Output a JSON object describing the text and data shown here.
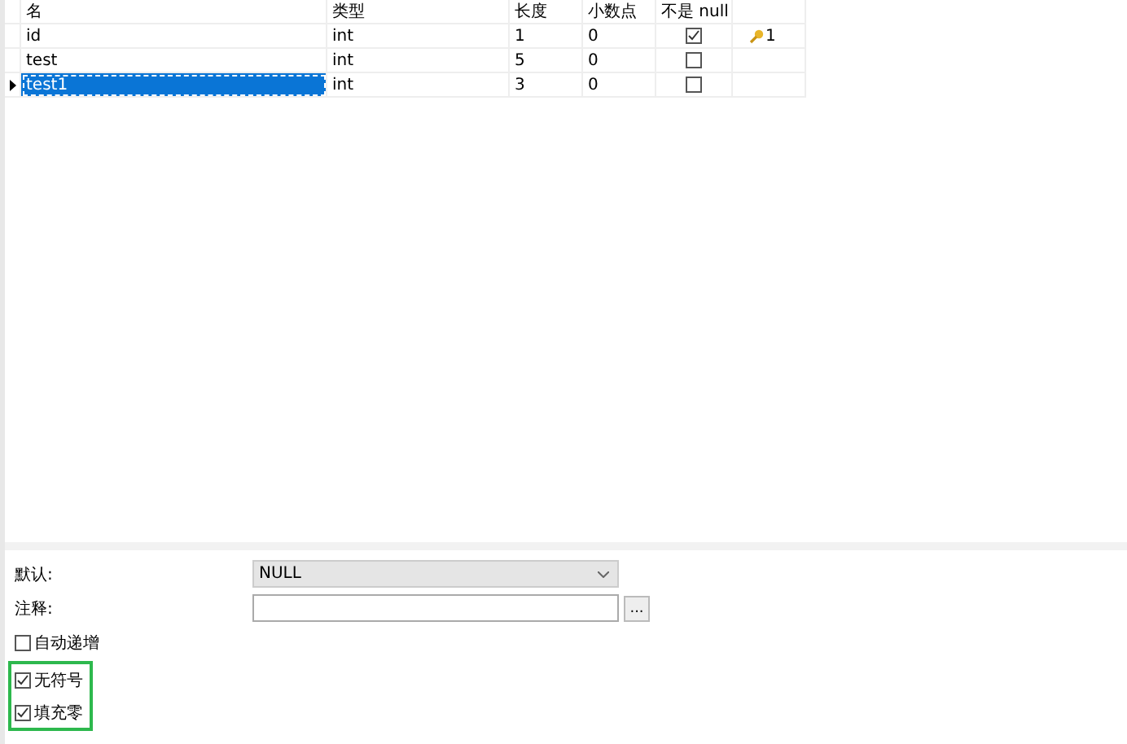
{
  "table": {
    "columns": [
      "名",
      "类型",
      "长度",
      "小数点",
      "不是 null"
    ],
    "rows": [
      {
        "name": "id",
        "type": "int",
        "length": "1",
        "decimals": "0",
        "not_null": true,
        "key": "1",
        "selected": false
      },
      {
        "name": "test",
        "type": "int",
        "length": "5",
        "decimals": "0",
        "not_null": false,
        "selected": false
      },
      {
        "name": "test1",
        "type": "int",
        "length": "3",
        "decimals": "0",
        "not_null": false,
        "selected": true
      }
    ]
  },
  "properties": {
    "default_label": "默认:",
    "default_value": "NULL",
    "comment_label": "注释:",
    "comment_button": "...",
    "options": [
      {
        "label": "自动递增",
        "checked": false,
        "highlighted": false
      },
      {
        "label": "无符号",
        "checked": true,
        "highlighted": true
      },
      {
        "label": "填充零",
        "checked": true,
        "highlighted": true
      }
    ]
  }
}
